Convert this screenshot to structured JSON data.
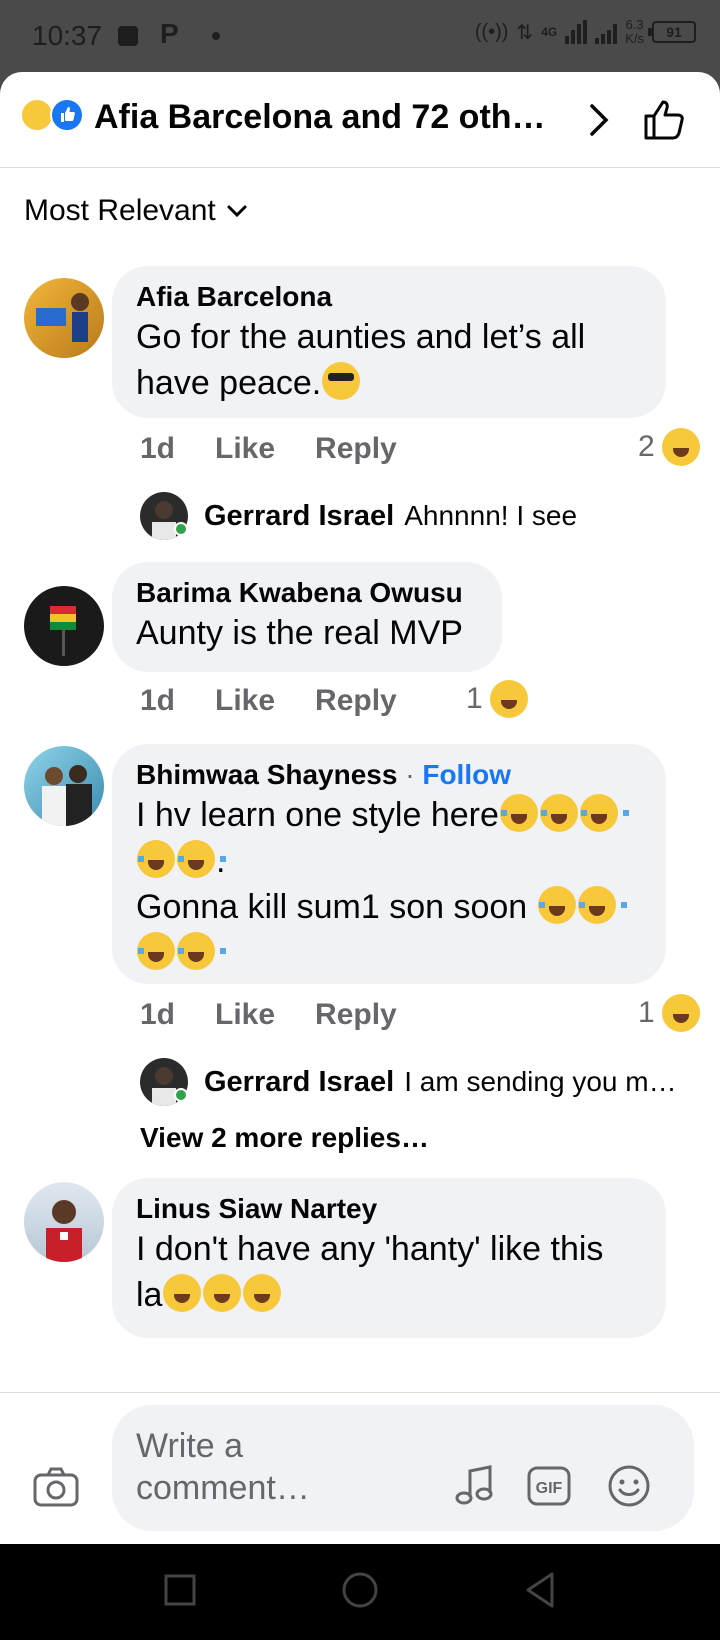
{
  "status_bar": {
    "time": "10:37",
    "network": "4G",
    "speed_value": "6.3",
    "speed_unit": "K/s",
    "battery": "91"
  },
  "header": {
    "title": "Afia Barcelona and 72 oth…",
    "reaction_icons": [
      "laugh-emoji",
      "like-icon"
    ]
  },
  "sort": {
    "label": "Most Relevant"
  },
  "comments": [
    {
      "name": "Afia Barcelona",
      "text_line1": "Go for the aunties and let’s all",
      "text_line2": "have peace.",
      "time": "1d",
      "like": "Like",
      "reply": "Reply",
      "reaction_count": "2"
    },
    {
      "name": "Barima Kwabena Owusu",
      "text": "Aunty is the real MVP",
      "time": "1d",
      "like": "Like",
      "reply": "Reply",
      "reaction_count": "1"
    },
    {
      "name": "Bhimwaa Shayness",
      "separator": " · ",
      "follow": "Follow",
      "line1": "I hv learn one style here",
      "line2_suffix": ".",
      "line3": "Gonna kill sum1 son soon ",
      "time": "1d",
      "like": "Like",
      "reply": "Reply",
      "reaction_count": "1"
    },
    {
      "name": "Linus Siaw Nartey",
      "text_line1": "I don't have any 'hanty' like this",
      "text_line2": "la"
    }
  ],
  "replies": [
    {
      "name": "Gerrard Israel",
      "text": "Ahnnnn! I see"
    },
    {
      "name": "Gerrard Israel",
      "text": "I am sending you m…"
    }
  ],
  "view_more": "View 2 more replies…",
  "composer": {
    "placeholder": "Write a comment…"
  },
  "colors": {
    "accent": "#1877f2",
    "bubble": "#f0f2f5",
    "muted": "#65676b",
    "emoji": "#f7c83a"
  }
}
